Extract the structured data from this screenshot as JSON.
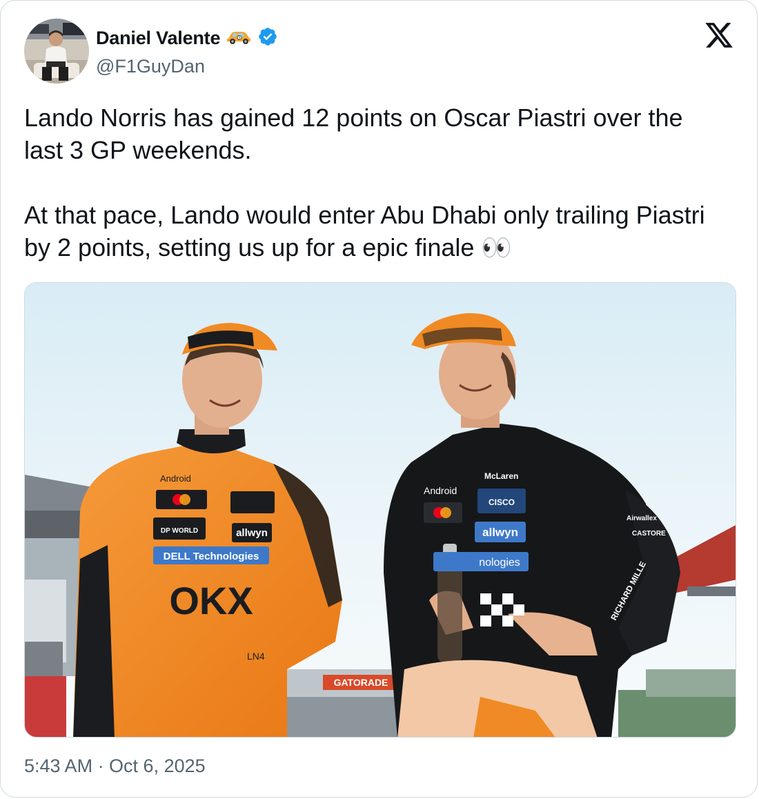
{
  "tweet": {
    "author": {
      "name": "Daniel Valente",
      "name_emoji": "race-car-emoji",
      "verified": true,
      "handle": "@F1GuyDan",
      "avatar_icon": "avatar-photo"
    },
    "text_paragraphs": [
      "Lando Norris has gained 12 points on Oscar Piastri over the last 3 GP weekends.",
      "At that pace, Lando would enter Abu Dhabi only trailing Piastri by 2 points, setting us up for a epic finale 👀"
    ],
    "media": {
      "left_sponsors": [
        "Android",
        "allwyn",
        "DP WORLD",
        "DELL Technologies",
        "OKX",
        "LN4"
      ],
      "right_sponsors": [
        "Android",
        "McLaren",
        "CISCO",
        "allwyn",
        "nologies",
        "RICHARD MILLE",
        "CASTORE",
        "Airwallex"
      ],
      "banner_text": "GATORADE"
    },
    "timestamp": "5:43 AM · Oct 6, 2025"
  },
  "brand": {
    "platform_icon": "x-logo-icon",
    "verified_color": "#1d9bf0",
    "text_color": "#0f1419",
    "muted_color": "#536471",
    "papaya": "#f08a24"
  }
}
